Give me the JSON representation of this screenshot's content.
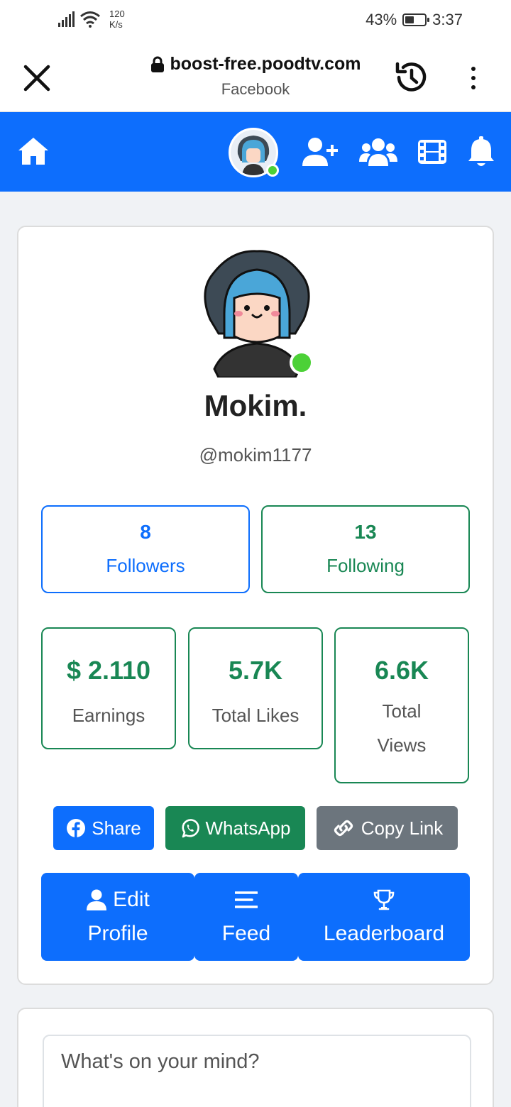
{
  "status_bar": {
    "net_speed_value": "120",
    "net_speed_unit": "K/s",
    "battery": "43%",
    "time": "3:37"
  },
  "browser": {
    "url": "boost-free.poodtv.com",
    "page_title": "Facebook"
  },
  "nav": {
    "icons": [
      "home-icon",
      "avatar",
      "add-friend-icon",
      "friends-icon",
      "video-icon",
      "bell-icon"
    ],
    "color": "#0d6efd"
  },
  "profile": {
    "name": "Mokim.",
    "handle": "@mokim1177",
    "followers_count": "8",
    "followers_label": "Followers",
    "following_count": "13",
    "following_label": "Following",
    "earnings_value": "$ 2.110",
    "earnings_label": "Earnings",
    "likes_value": "5.7K",
    "likes_label": "Total Likes",
    "views_value": "6.6K",
    "views_label_1": "Total",
    "views_label_2": "Views"
  },
  "share": {
    "share_label": "Share",
    "whatsapp_label": "WhatsApp",
    "copy_label": "Copy Link"
  },
  "actions": {
    "edit_1": "Edit",
    "edit_2": "Profile",
    "feed": "Feed",
    "leaderboard": "Leaderboard"
  },
  "composer": {
    "placeholder": "What's on your mind?"
  },
  "colors": {
    "primary": "#0d6efd",
    "success": "#198754",
    "secondary": "#6c757d",
    "online": "#4cd137"
  }
}
